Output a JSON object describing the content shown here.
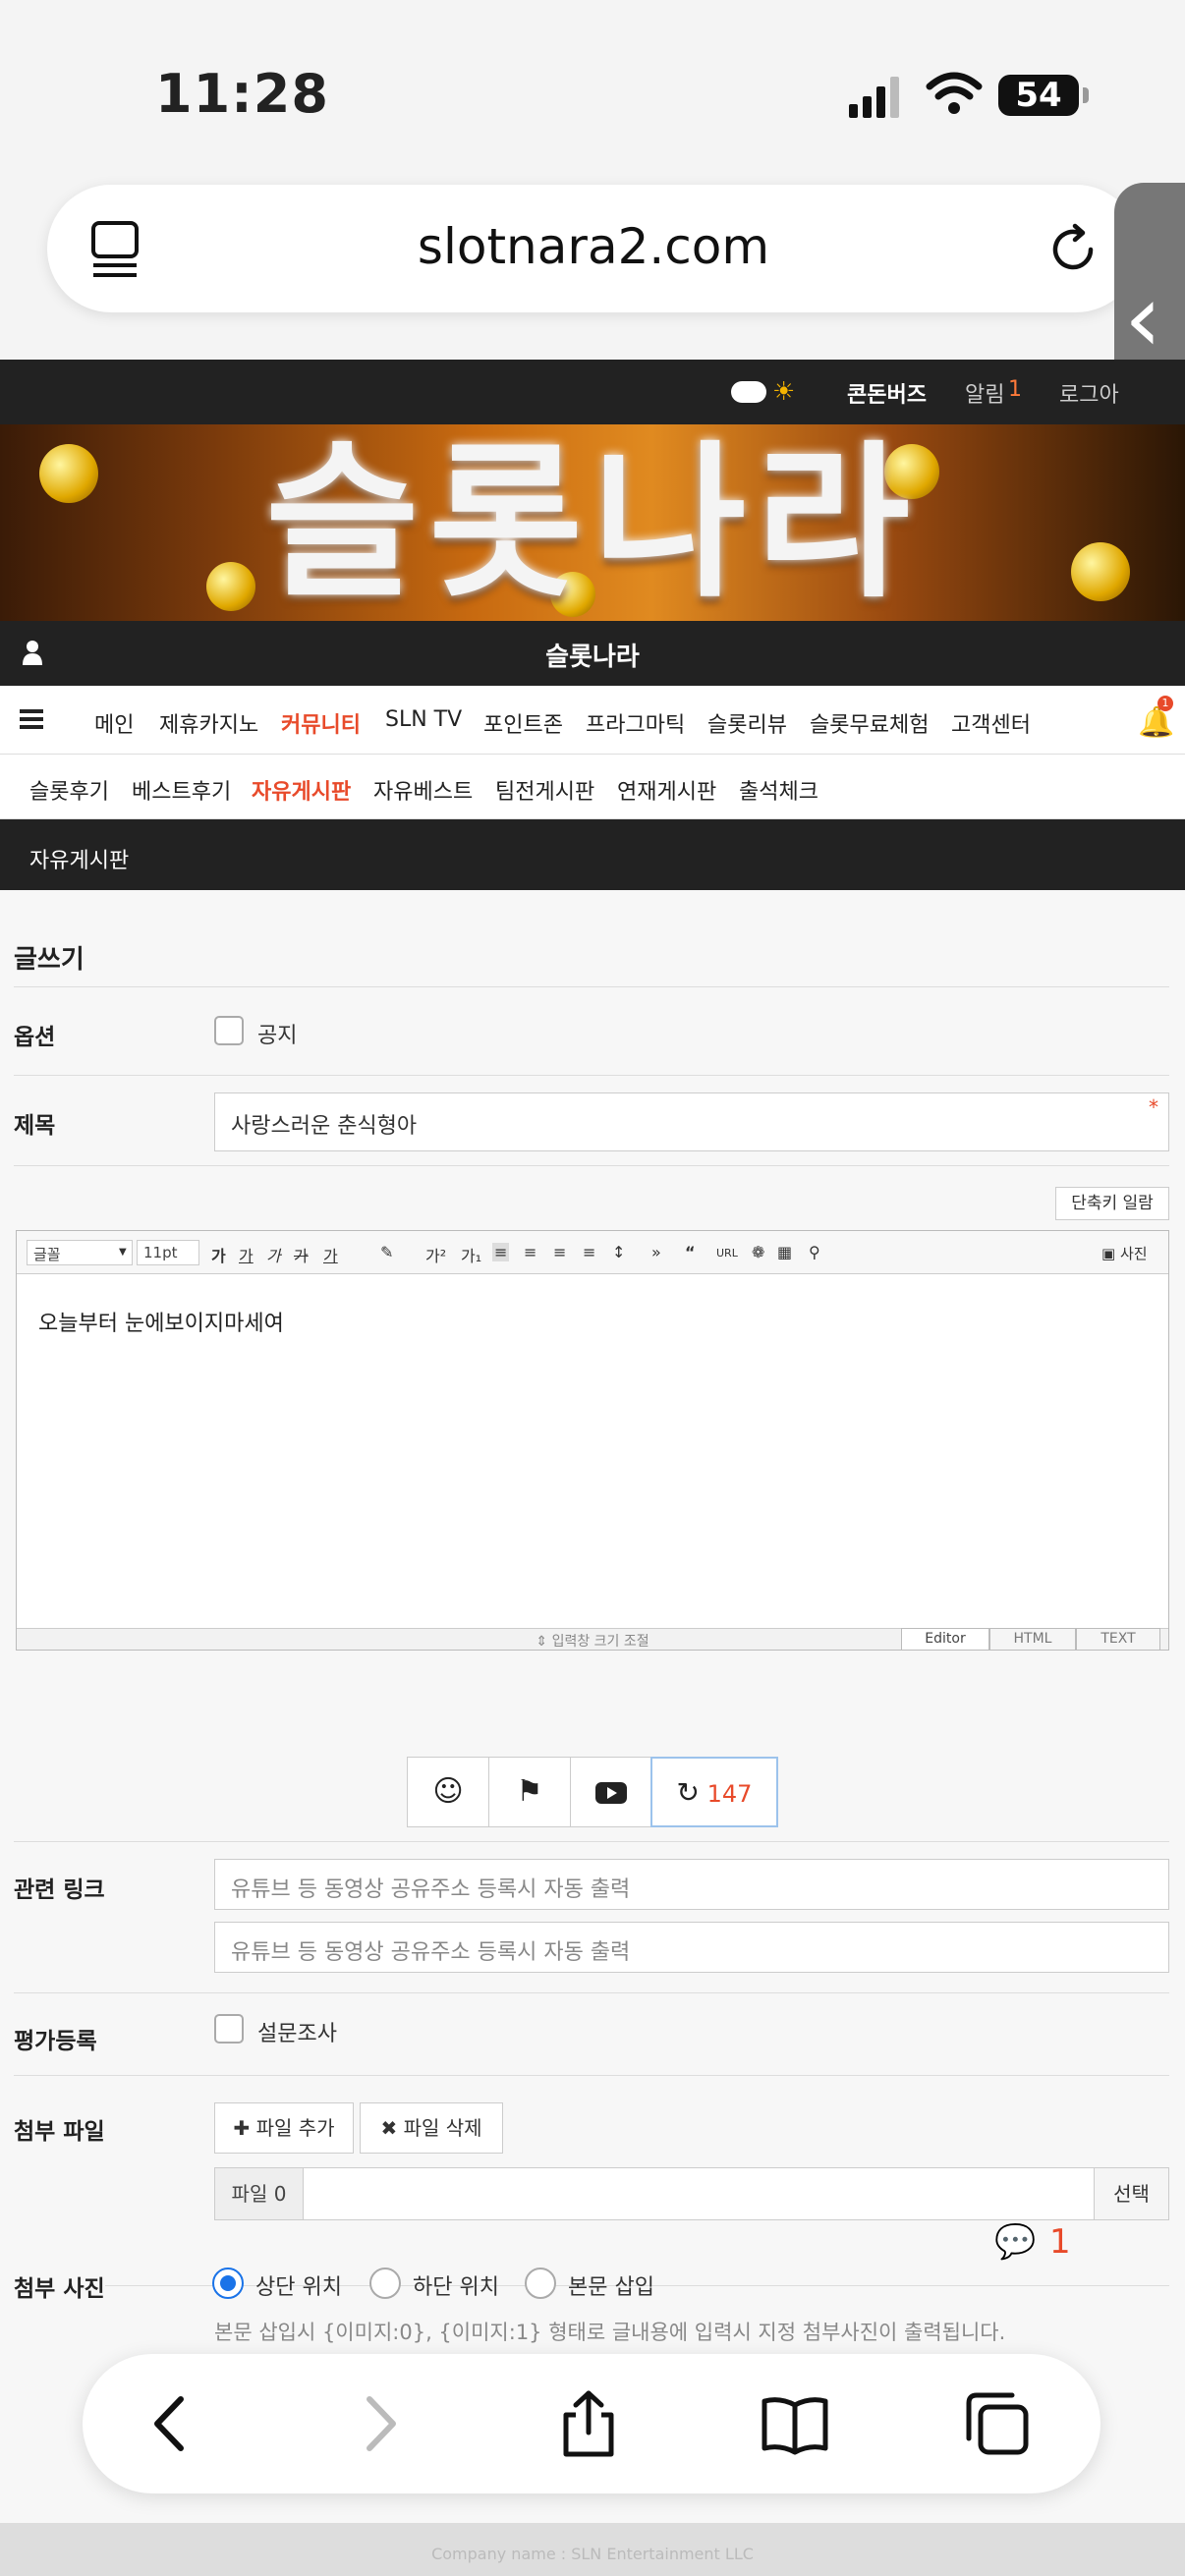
{
  "status_bar": {
    "time": "11:28",
    "battery": "54"
  },
  "browser": {
    "domain": "slotnara2.com"
  },
  "top_nav": {
    "links": [
      "콘돈버즈",
      "알림",
      "1",
      "로그아"
    ]
  },
  "banner": {
    "title": "슬롯나라"
  },
  "site_bar": {
    "name": "슬롯나라"
  },
  "main_menu": {
    "items": [
      "메인",
      "제휴카지노",
      "커뮤니티",
      "SLN TV",
      "포인트존",
      "프라그마틱",
      "슬롯리뷰",
      "슬롯무료체험",
      "고객센터"
    ],
    "active": "커뮤니티",
    "notification_count": "1"
  },
  "sub_menu": {
    "items": [
      "슬롯후기",
      "베스트후기",
      "자유게시판",
      "자유베스트",
      "팀전게시판",
      "연재게시판",
      "출석체크"
    ],
    "active": "자유게시판"
  },
  "board_title": "자유게시판",
  "form": {
    "heading": "글쓰기",
    "option_label": "옵션",
    "notice_label": "공지",
    "subject_label": "제목",
    "subject_value": "사랑스러운 춘식형아",
    "required_mark": "*",
    "shortcut_button": "단축키 일람",
    "toolbar": {
      "font": "글꼴",
      "size": "11pt",
      "photo": "사진",
      "url": "URL"
    },
    "editor_content": "오늘부터 눈에보이지마세여",
    "resize_label": "입력창 크기 조절",
    "editor_tabs": [
      "Editor",
      "HTML",
      "TEXT"
    ],
    "refresh_count": "147",
    "link_label": "관련 링크",
    "link_placeholder_1": "유튜브 등 동영상 공유주소 등록시 자동 출력",
    "link_placeholder_2": "유튜브 등 동영상 공유주소 등록시 자동 출력",
    "rating_label": "평가등록",
    "survey_label": "설문조사",
    "attach_label": "첨부 파일",
    "add_file": "파일 추가",
    "delete_file": "파일 삭제",
    "file_count_label": "파일 0",
    "select_button": "선택",
    "comment_count": "1",
    "photo_label": "첨부 사진",
    "photo_positions": [
      "상단 위치",
      "하단 위치",
      "본문 삽입"
    ],
    "photo_selected": "상단 위치",
    "photo_hint": "본문 삽입시 {이미지:0}, {이미지:1} 형태로 글내용에 입력시 지정 첨부사진이 출력됩니다."
  },
  "footer_text": "Company name : SLN Entertainment LLC"
}
